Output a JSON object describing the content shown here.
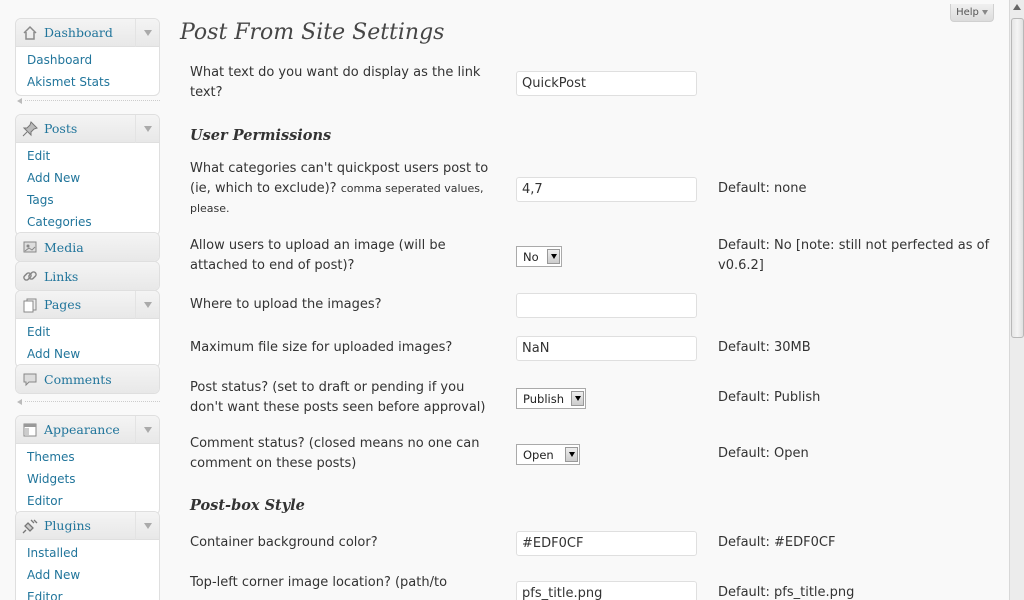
{
  "sidebar": {
    "groups": [
      {
        "id": "dashboard",
        "label": "Dashboard",
        "icon": "home-icon",
        "items": [
          "Dashboard",
          "Akismet Stats"
        ]
      },
      {
        "id": "posts",
        "label": "Posts",
        "icon": "pushpin-icon",
        "items": [
          "Edit",
          "Add New",
          "Tags",
          "Categories"
        ]
      },
      {
        "id": "media",
        "label": "Media",
        "icon": "media-icon",
        "items": []
      },
      {
        "id": "links",
        "label": "Links",
        "icon": "link-icon",
        "items": []
      },
      {
        "id": "pages",
        "label": "Pages",
        "icon": "pages-icon",
        "items": [
          "Edit",
          "Add New"
        ]
      },
      {
        "id": "comments",
        "label": "Comments",
        "icon": "comments-icon",
        "items": []
      },
      {
        "id": "appearance",
        "label": "Appearance",
        "icon": "appearance-icon",
        "items": [
          "Themes",
          "Widgets",
          "Editor"
        ]
      },
      {
        "id": "plugins",
        "label": "Plugins",
        "icon": "plugin-icon",
        "items": [
          "Installed",
          "Add New",
          "Editor"
        ]
      }
    ]
  },
  "help": {
    "label": "Help"
  },
  "page": {
    "title": "Post From Site Settings",
    "sections": {
      "user_permissions": "User Permissions",
      "postbox_style": "Post-box Style"
    },
    "rows": {
      "link_text": {
        "label": "What text do you want do display as the link text?",
        "value": "QuickPost"
      },
      "exclude_categories": {
        "label": "What categories can't quickpost users post to (ie, which to exclude)?",
        "note": "comma seperated values, please.",
        "value": "4,7",
        "default": "Default: none"
      },
      "allow_upload": {
        "label": "Allow users to upload an image (will be attached to end of post)?",
        "value": "No",
        "default": "Default: No [note: still not perfected as of v0.6.2]"
      },
      "upload_location": {
        "label": "Where to upload the images?",
        "value": ""
      },
      "max_file_size": {
        "label": "Maximum file size for uploaded images?",
        "value": "NaN",
        "default": "Default: 30MB"
      },
      "post_status": {
        "label": "Post status? (set to draft or pending if you don't want these posts seen before approval)",
        "value": "Publish",
        "default": "Default: Publish"
      },
      "comment_status": {
        "label": "Comment status? (closed means no one can comment on these posts)",
        "value": "Open",
        "default": "Default: Open"
      },
      "container_bg": {
        "label": "Container background color?",
        "value": "#EDF0CF",
        "default": "Default: #EDF0CF"
      },
      "topleft_image": {
        "label": "Top-left corner image location? (path/to",
        "value": "pfs_title.png",
        "default": "Default: pfs_title.png"
      }
    }
  },
  "colors": {
    "link": "#21759b",
    "border": "#dfdfdf",
    "background": "#f9f9f9"
  }
}
